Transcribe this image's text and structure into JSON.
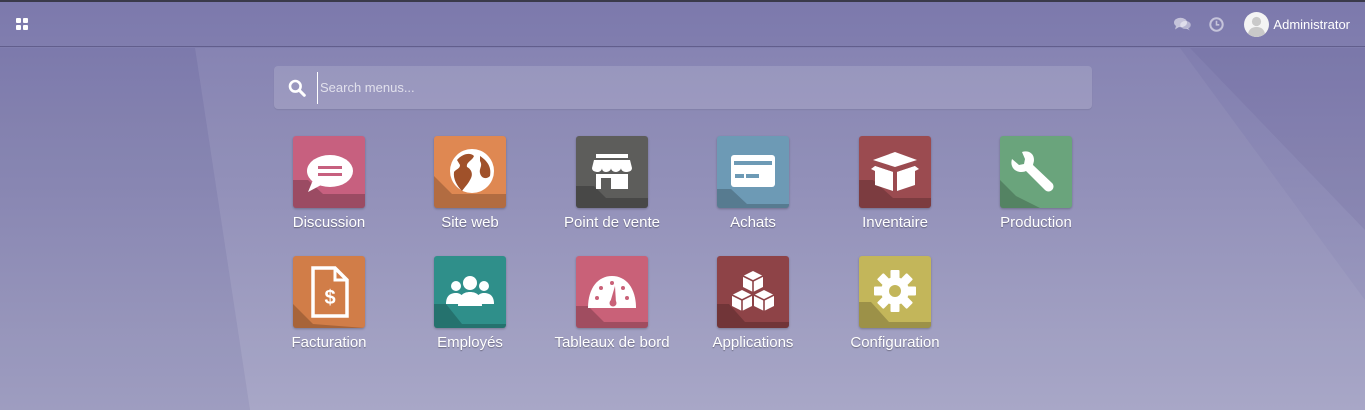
{
  "navbar": {
    "menu_icon": "apps-grid-icon",
    "chat_icon": "comments-icon",
    "activity_icon": "clock-icon",
    "user_name": "Administrator"
  },
  "search": {
    "placeholder": "Search menus...",
    "value": ""
  },
  "apps": [
    {
      "label": "Discussion",
      "icon": "chat-bubble-icon",
      "color": "#c7607f"
    },
    {
      "label": "Site web",
      "icon": "globe-icon",
      "color": "#df8852"
    },
    {
      "label": "Point de vente",
      "icon": "store-icon",
      "color": "#5d5d5b"
    },
    {
      "label": "Achats",
      "icon": "credit-card-icon",
      "color": "#6d9ab5"
    },
    {
      "label": "Inventaire",
      "icon": "open-box-icon",
      "color": "#9b4b50"
    },
    {
      "label": "Production",
      "icon": "wrench-icon",
      "color": "#6aa47c"
    },
    {
      "label": "Facturation",
      "icon": "invoice-dollar-icon",
      "color": "#d17d48"
    },
    {
      "label": "Employés",
      "icon": "users-icon",
      "color": "#2f8f8a"
    },
    {
      "label": "Tableaux de bord",
      "icon": "dashboard-gauge-icon",
      "color": "#c96178"
    },
    {
      "label": "Applications",
      "icon": "cubes-icon",
      "color": "#8e4347"
    },
    {
      "label": "Configuration",
      "icon": "cog-icon",
      "color": "#c3b65a"
    }
  ]
}
